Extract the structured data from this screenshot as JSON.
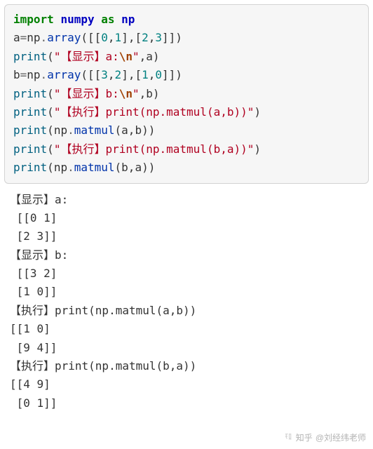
{
  "code": {
    "l1": {
      "import": "import",
      "numpy": "numpy",
      "as": "as",
      "np": "np"
    },
    "l2": {
      "a": "a",
      "eq": "=",
      "np": "np",
      "dot": ".",
      "array": "array",
      "open": "([[",
      "n0": "0",
      "c": ",",
      "n1": "1",
      "mid": "],[",
      "n2": "2",
      "n3": "3",
      "close": "]])"
    },
    "l3": {
      "print": "print",
      "open": "(",
      "s1": "\"【显示】a:",
      "esc": "\\n",
      "s1b": "\"",
      "c": ",",
      "a": "a",
      "close": ")"
    },
    "l4": {
      "b": "b",
      "eq": "=",
      "np": "np",
      "dot": ".",
      "array": "array",
      "open": "([[",
      "n0": "3",
      "c": ",",
      "n1": "2",
      "mid": "],[",
      "n2": "1",
      "n3": "0",
      "close": "]])"
    },
    "l5": {
      "print": "print",
      "open": "(",
      "s1": "\"【显示】b:",
      "esc": "\\n",
      "s1b": "\"",
      "c": ",",
      "b": "b",
      "close": ")"
    },
    "l6": {
      "print": "print",
      "open": "(",
      "s": "\"【执行】print(np.matmul(a,b))\"",
      "close": ")"
    },
    "l7": {
      "print": "print",
      "open": "(",
      "np": "np",
      "dot": ".",
      "matmul": "matmul",
      "p1": "(",
      "a": "a",
      "c": ",",
      "b": "b",
      "p2": "))"
    },
    "l8": {
      "print": "print",
      "open": "(",
      "s": "\"【执行】print(np.matmul(b,a))\"",
      "close": ")"
    },
    "l9": {
      "print": "print",
      "open": "(",
      "np": "np",
      "dot": ".",
      "matmul": "matmul",
      "p1": "(",
      "b": "b",
      "c": ",",
      "a": "a",
      "p2": "))"
    }
  },
  "output": {
    "l1": "【显示】a:",
    "l2": " [[0 1]",
    "l3": " [2 3]]",
    "l4": "【显示】b:",
    "l5": " [[3 2]",
    "l6": " [1 0]]",
    "l7": "【执行】print(np.matmul(a,b))",
    "l8": "[[1 0]",
    "l9": " [9 4]]",
    "l10": "【执行】print(np.matmul(b,a))",
    "l11": "[[4 9]",
    "l12": " [0 1]]"
  },
  "watermark": {
    "brand": "知乎",
    "author": "@刘经纬老师"
  }
}
